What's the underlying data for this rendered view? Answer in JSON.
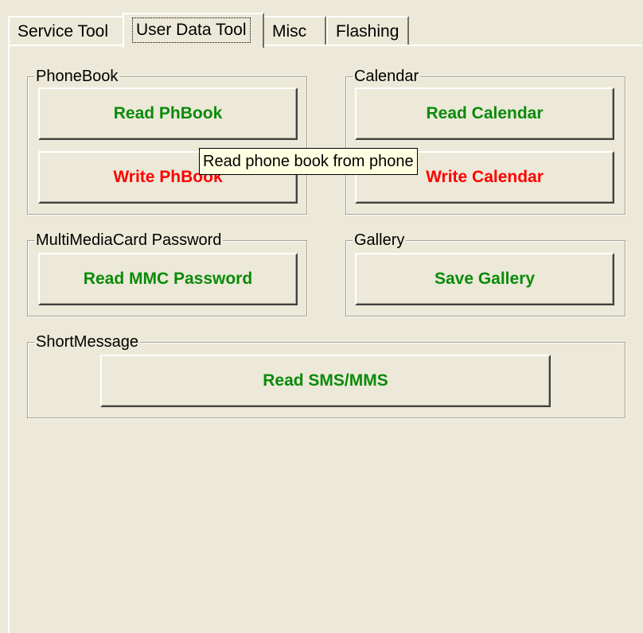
{
  "tabs": [
    {
      "label": "Service Tool",
      "active": false
    },
    {
      "label": "User Data Tool",
      "active": true
    },
    {
      "label": "Misc",
      "active": false
    },
    {
      "label": "Flashing",
      "active": false
    }
  ],
  "groups": {
    "phonebook": {
      "label": "PhoneBook",
      "read_label": "Read PhBook",
      "write_label": "Write PhBook"
    },
    "calendar": {
      "label": "Calendar",
      "read_label": "Read Calendar",
      "write_label": "Write Calendar"
    },
    "mmc": {
      "label": "MultiMediaCard Password",
      "read_label": "Read MMC Password"
    },
    "gallery": {
      "label": "Gallery",
      "save_label": "Save Gallery"
    },
    "sms": {
      "label": "ShortMessage",
      "read_label": "Read SMS/MMS"
    }
  },
  "tooltip": "Read phone book from phone",
  "colors": {
    "background": "#ece9d8",
    "read_button_text": "#0a8a0a",
    "write_button_text": "#ff0000",
    "tooltip_background": "#ffffe1"
  }
}
